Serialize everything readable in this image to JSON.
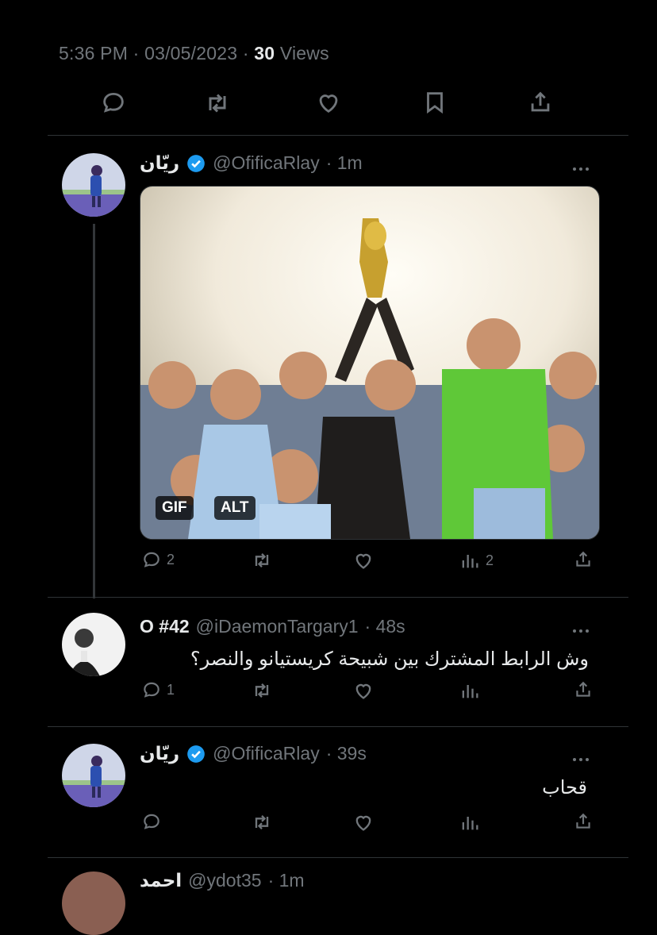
{
  "top_meta": {
    "time": "5:36 PM",
    "sep1": "·",
    "date": "03/05/2023",
    "sep2": "·",
    "views_count": "30",
    "views_label": "Views"
  },
  "tweets": [
    {
      "name": "ريّان",
      "handle": "@OfificaRlay",
      "time": "· 1m",
      "media_badges": [
        "GIF",
        "ALT"
      ],
      "reply_count": "2",
      "views_count": "2"
    },
    {
      "name": "O #42",
      "handle": "@iDaemonTargary1",
      "time": "· 48s",
      "text": "وش الرابط المشترك بين شبيحة كريستيانو والنصر؟",
      "reply_count": "1"
    },
    {
      "name": "ريّان",
      "handle": "@OfificaRlay",
      "time": "· 39s",
      "text": "قحاب"
    },
    {
      "name": "احمد",
      "handle": "@ydot35",
      "time": "· 1m"
    }
  ],
  "colors": {
    "background": "#000000",
    "text": "#e7e9ea",
    "muted": "#71767b",
    "verified": "#1d9bf0",
    "divider": "#2f3336"
  }
}
